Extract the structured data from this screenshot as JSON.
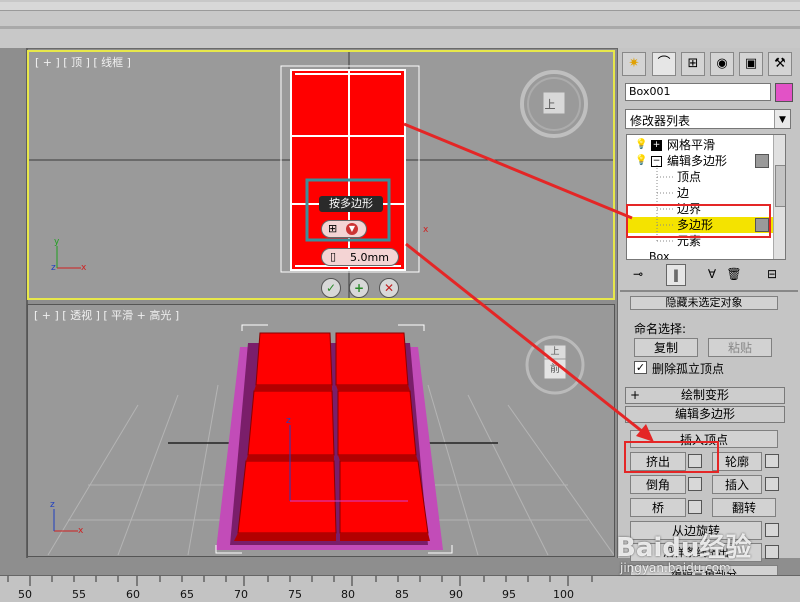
{
  "viewport_top": {
    "label": "[ + ] [ 顶 ] [ 线框 ]",
    "tooltip": "按多边形",
    "amount_value": "5.0mm",
    "cube_label": "上"
  },
  "viewport_persp": {
    "label": "[ + ] [ 透视 ] [ 平滑 + 高光 ]",
    "cube_label": "前",
    "cube_top_label": "上"
  },
  "command_panel": {
    "object_name": "Box001",
    "modifier_list": "修改器列表",
    "stack": {
      "items": [
        {
          "label": "网格平滑",
          "level": 0,
          "expander": "+"
        },
        {
          "label": "编辑多边形",
          "level": 0,
          "expander": "−"
        },
        {
          "label": "顶点",
          "level": 1
        },
        {
          "label": "边",
          "level": 1
        },
        {
          "label": "边界",
          "level": 1
        },
        {
          "label": "多边形",
          "level": 1,
          "selected": true
        },
        {
          "label": "元素",
          "level": 1
        },
        {
          "label": "Box",
          "level": 0
        }
      ]
    },
    "partial_top": "隐藏未选定对象",
    "named_selection": "命名选择:",
    "copy": "复制",
    "paste": "粘贴",
    "delete_isolated": "删除孤立顶点",
    "paint_deform": "绘制变形",
    "edit_polygons_title": "编辑多边形",
    "insert_vertex": "插入顶点",
    "extrude": "挤出",
    "outline": "轮廓",
    "bevel": "倒角",
    "inset": "插入",
    "bridge": "桥",
    "flip": "翻转",
    "hinge_rotate": "从边旋转",
    "extrude_spline": "沿样条线挤出",
    "edit_triangulation": "编辑三角剖分"
  },
  "ruler": {
    "ticks": [
      "50",
      "55",
      "60",
      "65",
      "70",
      "75",
      "80",
      "85",
      "90",
      "95",
      "100"
    ]
  },
  "watermark": {
    "brand": "Baidu经验",
    "url": "jingyan.baidu.com"
  },
  "colors": {
    "object_red": "#ff0000",
    "selection_yellow": "#f4e300",
    "highlight_red": "#e42626",
    "object_color": "#e252c6"
  }
}
